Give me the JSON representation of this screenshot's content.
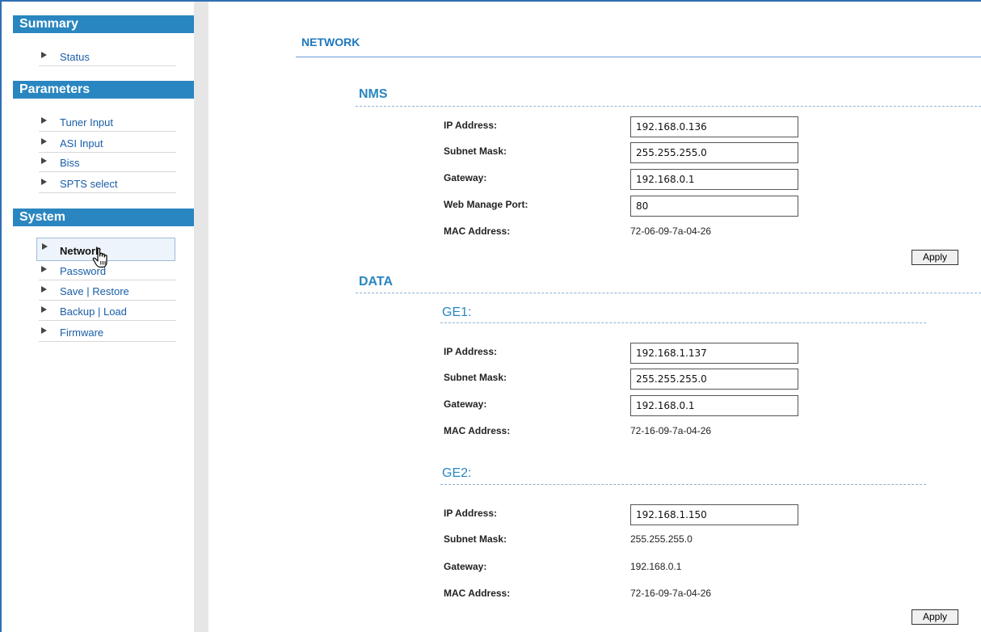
{
  "sidebar": {
    "summary": {
      "header": "Summary",
      "items": [
        "Status"
      ]
    },
    "parameters": {
      "header": "Parameters",
      "items": [
        "Tuner Input",
        "ASI Input",
        "Biss",
        "SPTS select"
      ]
    },
    "system": {
      "header": "System",
      "items": [
        "Network",
        "Password",
        "Save | Restore",
        "Backup | Load",
        "Firmware"
      ]
    }
  },
  "main": {
    "title": "NETWORK",
    "nms": {
      "title": "NMS",
      "ip_label": "IP Address:",
      "ip_value": "192.168.0.136",
      "mask_label": "Subnet Mask:",
      "mask_value": "255.255.255.0",
      "gateway_label": "Gateway:",
      "gateway_value": "192.168.0.1",
      "port_label": "Web Manage Port:",
      "port_value": "80",
      "mac_label": "MAC Address:",
      "mac_value": "72-06-09-7a-04-26",
      "apply": "Apply"
    },
    "data": {
      "title": "DATA",
      "ge1": {
        "title": "GE1:",
        "ip_label": "IP Address:",
        "ip_value": "192.168.1.137",
        "mask_label": "Subnet Mask:",
        "mask_value": "255.255.255.0",
        "gateway_label": "Gateway:",
        "gateway_value": "192.168.0.1",
        "mac_label": "MAC Address:",
        "mac_value": "72-16-09-7a-04-26"
      },
      "ge2": {
        "title": "GE2:",
        "ip_label": "IP Address:",
        "ip_value": "192.168.1.150",
        "mask_label": "Subnet Mask:",
        "mask_value": "255.255.255.0",
        "gateway_label": "Gateway:",
        "gateway_value": "192.168.0.1",
        "mac_label": "MAC Address:",
        "mac_value": "72-16-09-7a-04-26"
      },
      "apply": "Apply"
    }
  },
  "colors": {
    "accent": "#2a86c0",
    "link": "#1a5ea8",
    "frame": "#2e6fb4"
  }
}
